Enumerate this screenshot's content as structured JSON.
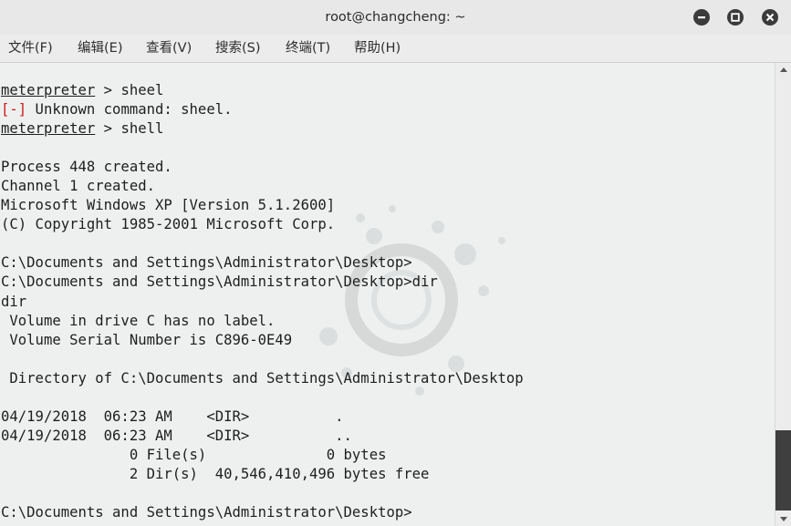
{
  "window": {
    "title": "root@changcheng: ~",
    "minimize_icon": "minimize-icon",
    "maximize_icon": "maximize-icon",
    "close_icon": "close-icon"
  },
  "menu": {
    "items": [
      "文件(F)",
      "编辑(E)",
      "查看(V)",
      "搜索(S)",
      "终端(T)",
      "帮助(H)"
    ]
  },
  "terminal": {
    "prompt": "meterpreter",
    "lines": [
      {
        "prompt": "meterpreter",
        "text": " > sheel"
      },
      {
        "err": "[-]",
        "text": " Unknown command: sheel."
      },
      {
        "prompt": "meterpreter",
        "text": " > shell"
      },
      {
        "text": ""
      },
      {
        "text": "Process 448 created."
      },
      {
        "text": "Channel 1 created."
      },
      {
        "text": "Microsoft Windows XP [Version 5.1.2600]"
      },
      {
        "text": "(C) Copyright 1985-2001 Microsoft Corp."
      },
      {
        "text": ""
      },
      {
        "text": "C:\\Documents and Settings\\Administrator\\Desktop>"
      },
      {
        "text": "C:\\Documents and Settings\\Administrator\\Desktop>dir"
      },
      {
        "text": "dir"
      },
      {
        "text": " Volume in drive C has no label."
      },
      {
        "text": " Volume Serial Number is C896-0E49"
      },
      {
        "text": ""
      },
      {
        "text": " Directory of C:\\Documents and Settings\\Administrator\\Desktop"
      },
      {
        "text": ""
      },
      {
        "text": "04/19/2018  06:23 AM    <DIR>          ."
      },
      {
        "text": "04/19/2018  06:23 AM    <DIR>          .."
      },
      {
        "text": "               0 File(s)              0 bytes"
      },
      {
        "text": "               2 Dir(s)  40,546,410,496 bytes free"
      },
      {
        "text": ""
      },
      {
        "text": "C:\\Documents and Settings\\Administrator\\Desktop>"
      }
    ]
  },
  "colors": {
    "error_red": "#cc1a1a",
    "terminal_bg": "#eef0f0",
    "scroll_thumb": "#3f3f3f"
  }
}
